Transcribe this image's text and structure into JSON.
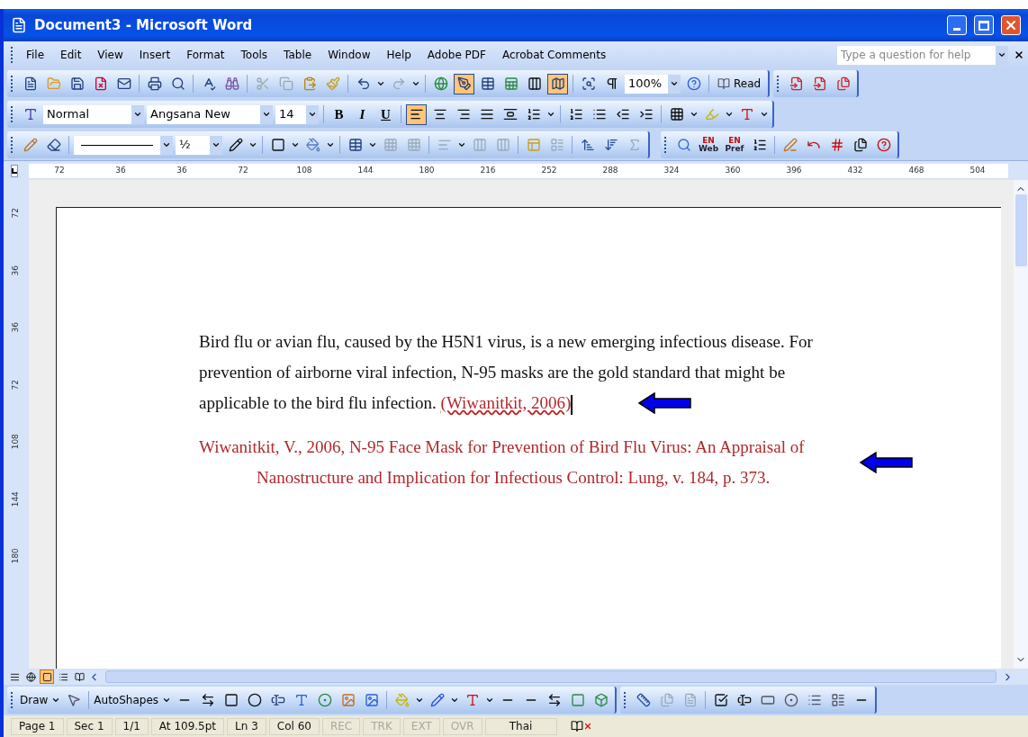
{
  "window": {
    "title": "Document3 - Microsoft Word"
  },
  "menu": [
    "File",
    "Edit",
    "View",
    "Insert",
    "Format",
    "Tools",
    "Table",
    "Window",
    "Help",
    "Adobe PDF",
    "Acrobat Comments"
  ],
  "help_box": {
    "placeholder": "Type a question for help"
  },
  "standard_toolbar": {
    "zoom": "100%",
    "read": "Read"
  },
  "formatting_toolbar": {
    "style": "Normal",
    "font": "Angsana New",
    "size": "14",
    "bold": "B",
    "italic": "I",
    "underline": "U",
    "align": [
      {
        "selected": true
      },
      {
        "selected": false
      },
      {
        "selected": false
      },
      {
        "selected": false
      },
      {
        "selected": false
      }
    ]
  },
  "tables_toolbar": {
    "line_weight": "½"
  },
  "reference_toolbar": {
    "lookup_web": [
      "EN",
      "Web"
    ],
    "lookup_pref": [
      "EN",
      "Pref"
    ]
  },
  "ruler": {
    "horizontal": [
      "72",
      "36",
      "36",
      "72",
      "108",
      "144",
      "180",
      "216",
      "252",
      "288",
      "324",
      "360",
      "396",
      "432",
      "468",
      "504"
    ],
    "vertical": [
      "72",
      "36",
      "36",
      "72",
      "108",
      "144",
      "180"
    ]
  },
  "document": {
    "paragraph": "Bird flu or avian flu, caused by the H5N1 virus, is a new emerging infectious disease. For prevention of airborne viral infection, N-95 masks are the gold standard that might be applicable to the bird flu infection.",
    "citation": "(Wiwanitkit, 2006)",
    "reference": "Wiwanitkit, V., 2006, N-95 Face Mask for Prevention of Bird Flu Virus: An Appraisal of Nanostructure and Implication for Infectious Control: Lung, v. 184, p. 373."
  },
  "view_buttons": [
    {
      "selected": false
    },
    {
      "selected": false
    },
    {
      "selected": true
    },
    {
      "selected": false
    },
    {
      "selected": false
    }
  ],
  "draw_toolbar": {
    "draw": "Draw",
    "autoshapes": "AutoShapes"
  },
  "status_bar": [
    {
      "text": "Page 1",
      "disabled": false
    },
    {
      "text": "Sec 1",
      "disabled": false
    },
    {
      "text": "1/1",
      "disabled": false
    },
    {
      "text": "At 109.5pt",
      "disabled": false
    },
    {
      "text": "Ln 3",
      "disabled": false
    },
    {
      "text": "Col 60",
      "disabled": false
    },
    {
      "text": "REC",
      "disabled": true
    },
    {
      "text": "TRK",
      "disabled": true
    },
    {
      "text": "EXT",
      "disabled": true
    },
    {
      "text": "OVR",
      "disabled": true
    },
    {
      "text": "Thai",
      "disabled": false
    }
  ]
}
